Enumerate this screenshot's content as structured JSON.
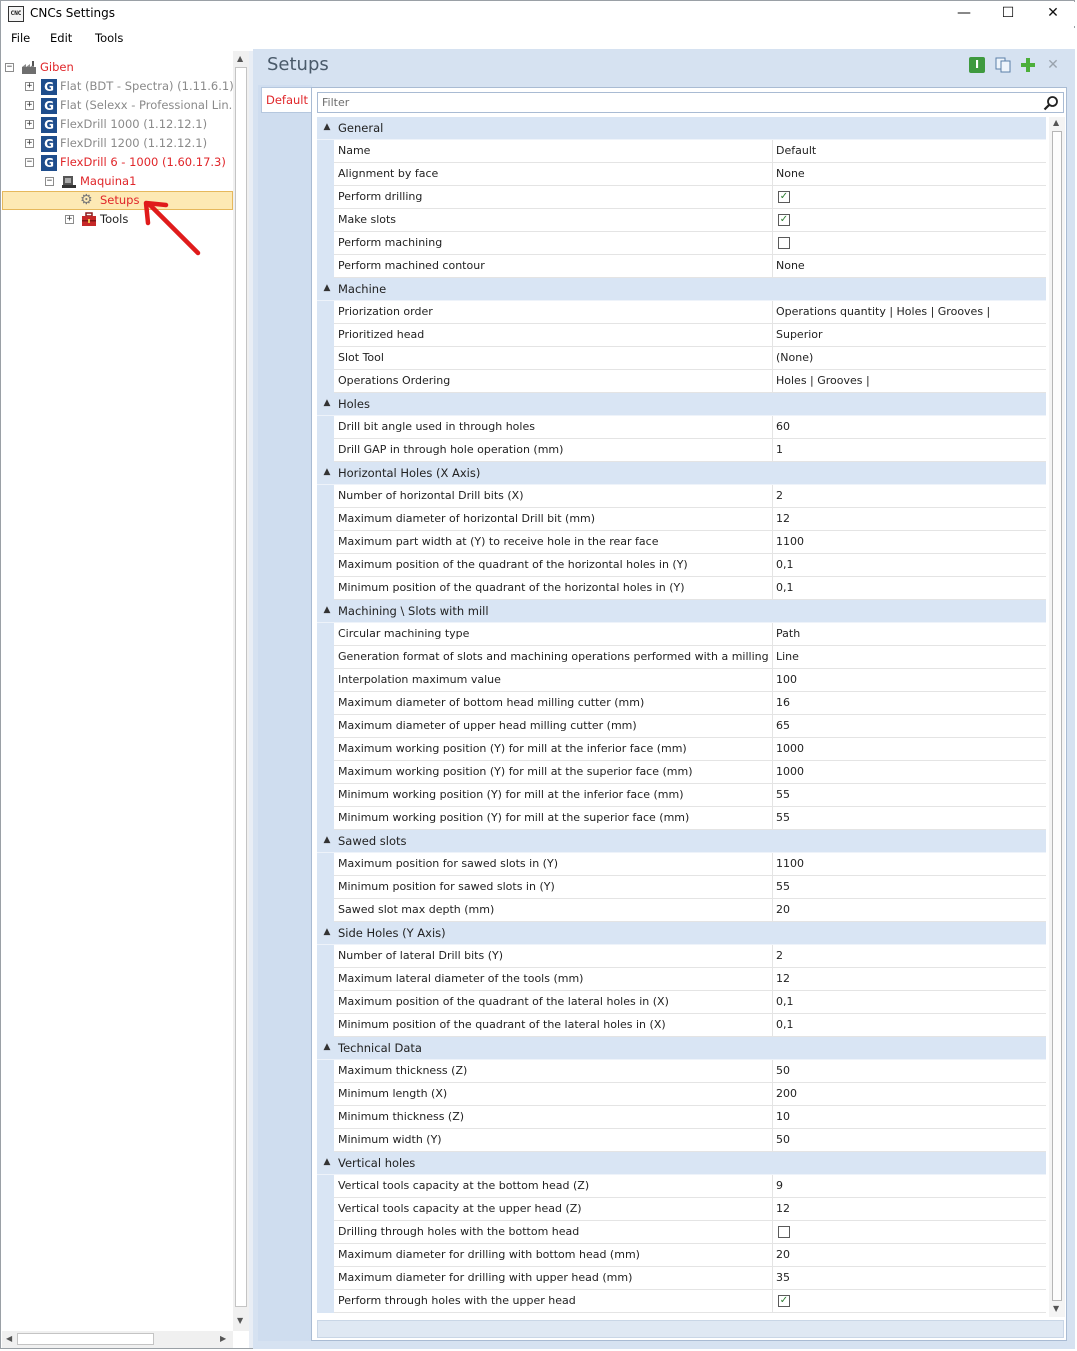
{
  "window": {
    "title": "CNCs Settings",
    "icon_text": "CNC",
    "min": "—",
    "max": "☐",
    "close": "✕"
  },
  "menu": [
    "File",
    "Edit",
    "Tools"
  ],
  "tree": {
    "root": "Giben",
    "machines": [
      {
        "label": "Flat (BDT - Spectra) (1.11.6.1)"
      },
      {
        "label": "Flat (Selexx - Professional Lin..."
      },
      {
        "label": "FlexDrill 1000 (1.12.12.1)"
      },
      {
        "label": "FlexDrill 1200 (1.12.12.1)"
      },
      {
        "label": "FlexDrill 6 - 1000 (1.60.17.3)"
      }
    ],
    "machine_node": "Maquina1",
    "setups": "Setups",
    "tools": "Tools"
  },
  "panel": {
    "title": "Setups",
    "tab": "Default",
    "filter_placeholder": "Filter"
  },
  "colors": {
    "accent_red": "#e0262a",
    "header_blue": "#d9e5f4",
    "selection": "#fde9b4"
  },
  "categories": [
    {
      "name": "General",
      "rows": [
        {
          "name": "Name",
          "value": "Default"
        },
        {
          "name": "Alignment by face",
          "value": "None"
        },
        {
          "name": "Perform drilling",
          "value": "",
          "check": true
        },
        {
          "name": "Make slots",
          "value": "",
          "check": true
        },
        {
          "name": "Perform machining",
          "value": "",
          "check": false
        },
        {
          "name": "Perform machined contour",
          "value": "None"
        }
      ]
    },
    {
      "name": "Machine",
      "rows": [
        {
          "name": "Priorization order",
          "value": "Operations quantity | Holes | Grooves |"
        },
        {
          "name": "Prioritized head",
          "value": "Superior"
        },
        {
          "name": "Slot Tool",
          "value": "(None)"
        },
        {
          "name": "Operations Ordering",
          "value": "Holes | Grooves |"
        }
      ]
    },
    {
      "name": "Holes",
      "rows": [
        {
          "name": "Drill bit angle used in through holes",
          "value": "60"
        },
        {
          "name": "Drill GAP in through hole operation (mm)",
          "value": "1"
        }
      ]
    },
    {
      "name": "Horizontal Holes (X Axis)",
      "rows": [
        {
          "name": "Number of horizontal Drill bits (X)",
          "value": "2"
        },
        {
          "name": "Maximum diameter of horizontal Drill bit (mm)",
          "value": "12"
        },
        {
          "name": "Maximum part width at (Y) to receive hole in the rear face",
          "value": "1100"
        },
        {
          "name": "Maximum position of the quadrant of the horizontal holes in (Y)",
          "value": "0,1"
        },
        {
          "name": "Minimum position of the quadrant of the horizontal holes in (Y)",
          "value": "0,1"
        }
      ]
    },
    {
      "name": "Machining \\ Slots with mill",
      "rows": [
        {
          "name": "Circular machining type",
          "value": "Path"
        },
        {
          "name": "Generation format of slots and machining operations performed with a milling cutter",
          "value": "Line"
        },
        {
          "name": "Interpolation maximum value",
          "value": "100"
        },
        {
          "name": "Maximum diameter of bottom head milling cutter (mm)",
          "value": "16"
        },
        {
          "name": "Maximum diameter of upper head milling cutter (mm)",
          "value": "65"
        },
        {
          "name": "Maximum working position (Y) for mill at the inferior face (mm)",
          "value": "1000"
        },
        {
          "name": "Maximum working position (Y) for mill at the superior face (mm)",
          "value": "1000"
        },
        {
          "name": "Minimum working position (Y) for mill at the inferior face (mm)",
          "value": "55"
        },
        {
          "name": "Minimum working position (Y) for mill at the superior face (mm)",
          "value": "55"
        }
      ]
    },
    {
      "name": "Sawed slots",
      "rows": [
        {
          "name": "Maximum position for sawed slots in (Y)",
          "value": "1100"
        },
        {
          "name": "Minimum position for sawed slots in (Y)",
          "value": "55"
        },
        {
          "name": "Sawed slot max depth (mm)",
          "value": "20"
        }
      ]
    },
    {
      "name": "Side Holes (Y Axis)",
      "rows": [
        {
          "name": "Number of lateral Drill bits (Y)",
          "value": "2"
        },
        {
          "name": "Maximum lateral diameter of the tools (mm)",
          "value": "12"
        },
        {
          "name": "Maximum position of the quadrant of the lateral holes in (X)",
          "value": "0,1"
        },
        {
          "name": "Minimum position of the quadrant of the lateral holes in (X)",
          "value": "0,1"
        }
      ]
    },
    {
      "name": "Technical Data",
      "rows": [
        {
          "name": "Maximum thickness (Z)",
          "value": "50"
        },
        {
          "name": "Minimum length (X)",
          "value": "200"
        },
        {
          "name": "Minimum thickness (Z)",
          "value": "10"
        },
        {
          "name": "Minimum width (Y)",
          "value": "50"
        }
      ]
    },
    {
      "name": "Vertical holes",
      "rows": [
        {
          "name": "Vertical tools capacity at the bottom head (Z)",
          "value": "9"
        },
        {
          "name": "Vertical tools capacity at the upper head (Z)",
          "value": "12"
        },
        {
          "name": "Drilling through holes with the bottom head",
          "value": "",
          "check": false
        },
        {
          "name": "Maximum diameter for drilling with bottom head (mm)",
          "value": "20"
        },
        {
          "name": "Maximum diameter for drilling with upper head (mm)",
          "value": "35"
        },
        {
          "name": "Perform through holes with the upper head",
          "value": "",
          "check": true
        }
      ]
    }
  ]
}
